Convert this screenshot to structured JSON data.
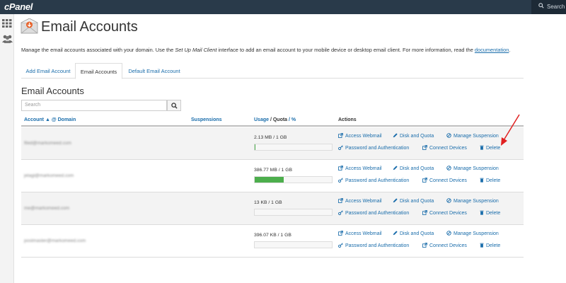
{
  "topbar": {
    "brand": "cPanel",
    "search_placeholder": "Search ( /"
  },
  "header": {
    "title": "Email Accounts",
    "description_before": "Manage the email accounts associated with your domain. Use the ",
    "description_em": "Set Up Mail Client",
    "description_after": " interface to add an email account to your mobile device or desktop email client. For more information, read the ",
    "doc_link": "documentation",
    "period": "."
  },
  "tabs": [
    {
      "label": "Add Email Account"
    },
    {
      "label": "Email Accounts",
      "active": true
    },
    {
      "label": "Default Email Account"
    }
  ],
  "section_title": "Email Accounts",
  "search": {
    "placeholder": "Search"
  },
  "table": {
    "col_account": "Account",
    "col_domain": "@ Domain",
    "col_suspensions": "Suspensions",
    "col_usage": "Usage",
    "col_quota": "/ Quota",
    "col_percent": "/ %",
    "col_actions": "Actions",
    "rows": [
      {
        "account": "filed@markomeed.com",
        "usage": "2.13 MB / 1 GB",
        "percent": 0.2
      },
      {
        "account": "jelagi@markomeed.com",
        "usage": "386.77 MB / 1 GB",
        "percent": 37.8
      },
      {
        "account": "me@markomeed.com",
        "usage": "13 KB / 1 GB",
        "percent": 0
      },
      {
        "account": "postmaster@markomeed.com",
        "usage": "396.07 KB / 1 GB",
        "percent": 0.04
      }
    ],
    "actions": {
      "webmail": "Access Webmail",
      "disk": "Disk and Quota",
      "suspension": "Manage Suspension",
      "password": "Password and Authentication",
      "devices": "Connect Devices",
      "delete": "Delete"
    }
  },
  "colors": {
    "link": "#1a6dab",
    "bar_fill": "#4cae4c",
    "topbar": "#293a4a",
    "annotation_arrow": "#e02020"
  }
}
